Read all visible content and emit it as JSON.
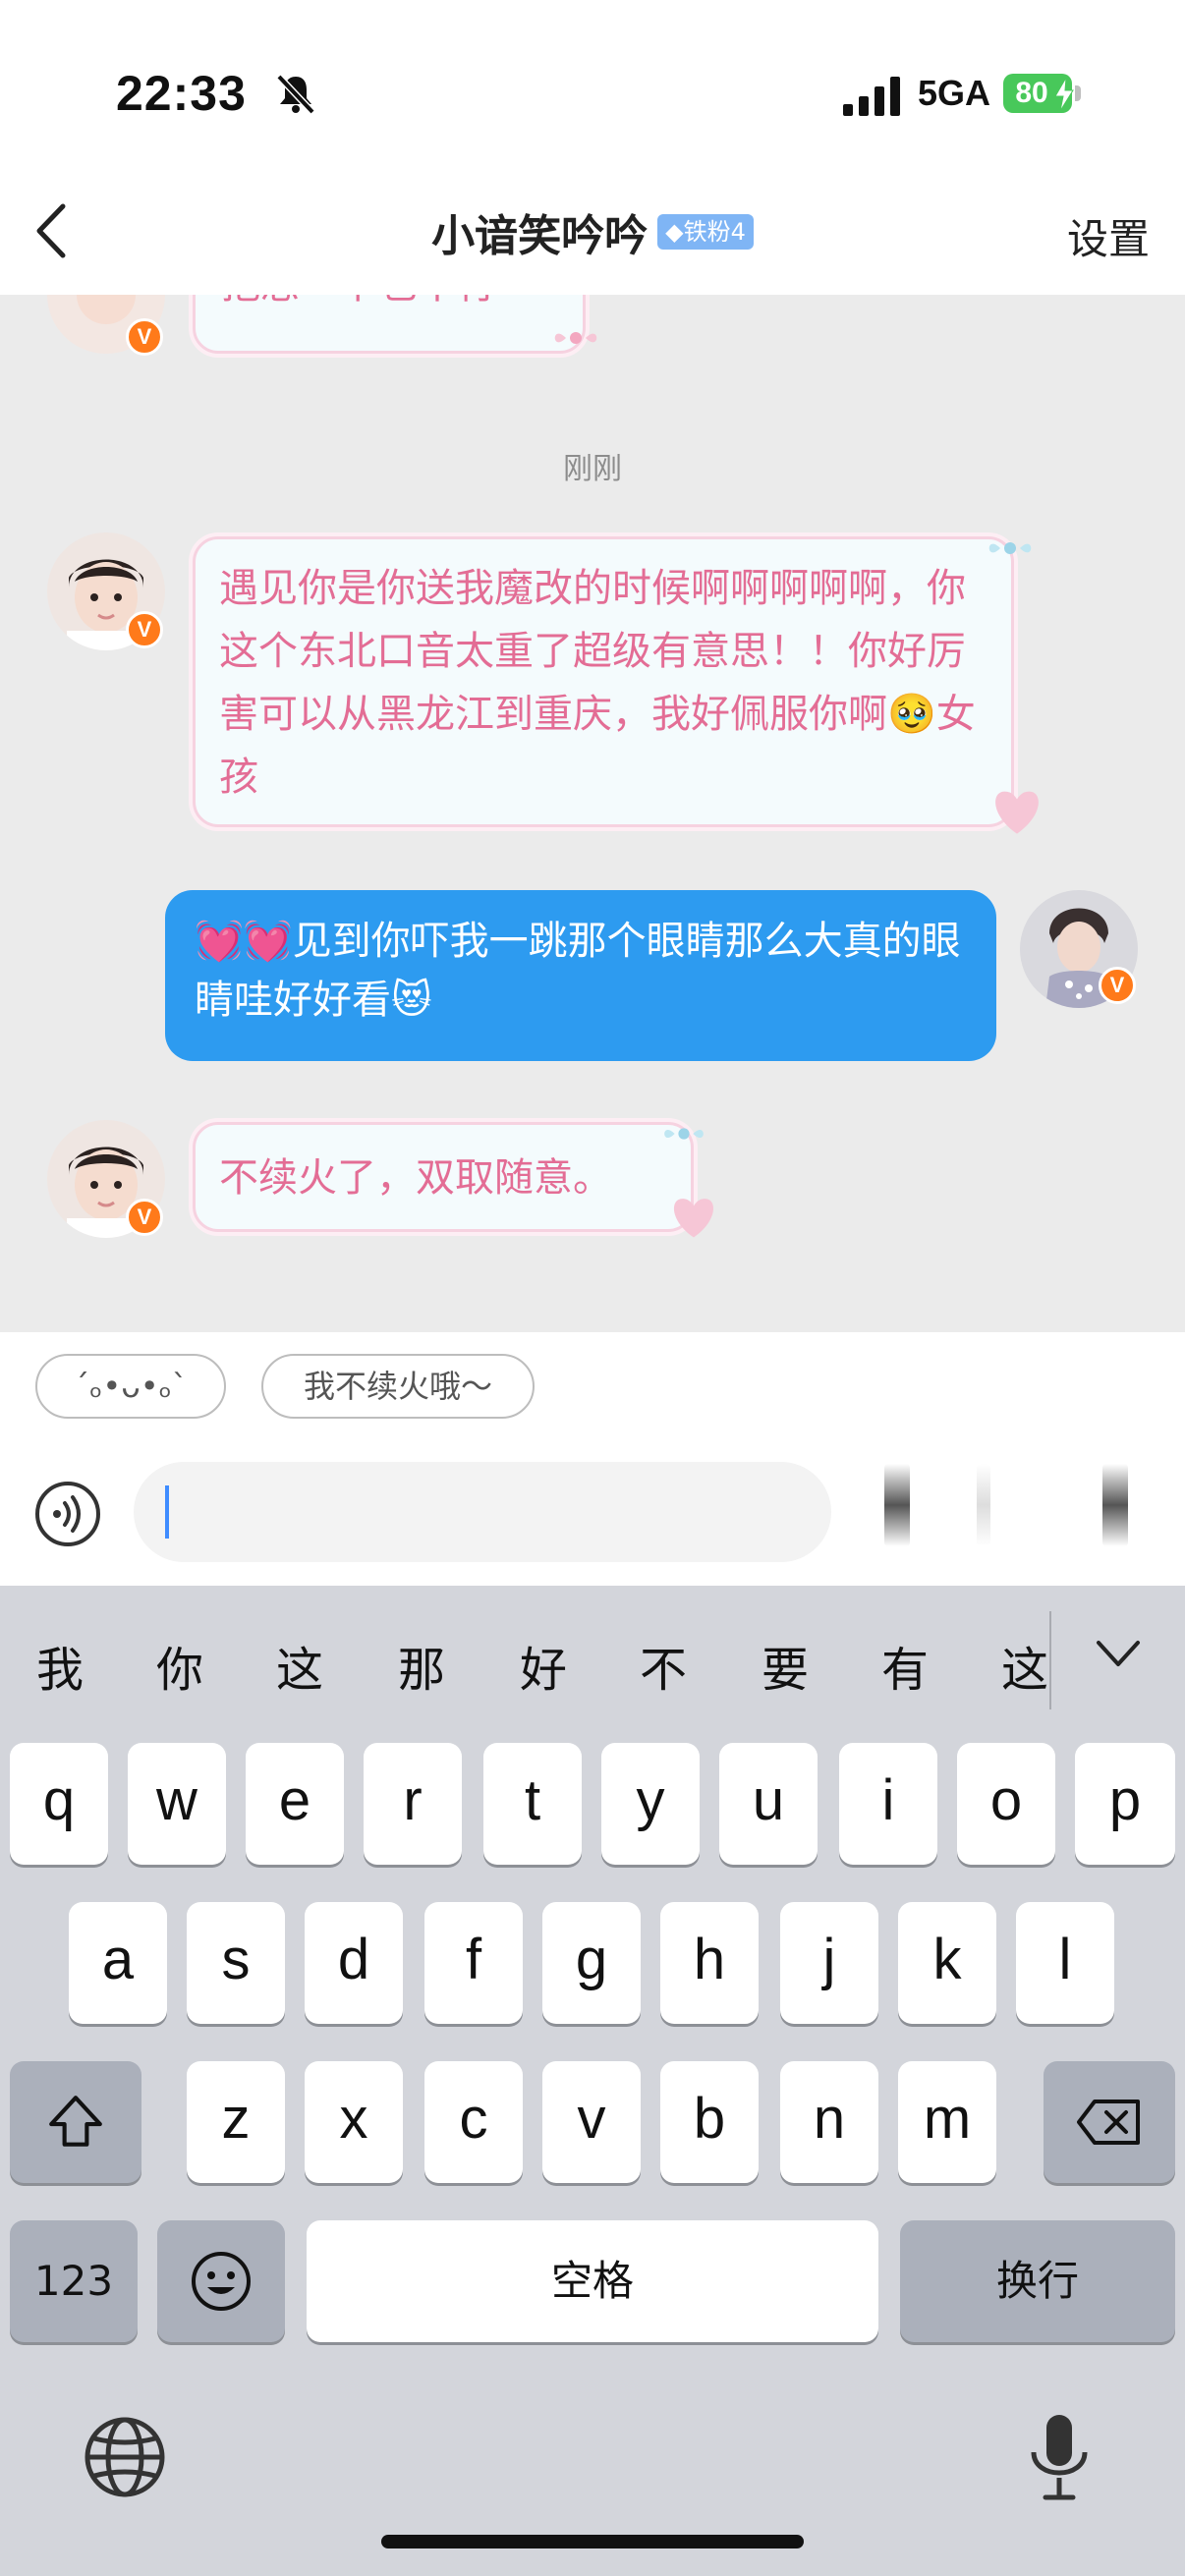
{
  "status_bar": {
    "time": "22:33",
    "network": "5GA",
    "battery": "80",
    "icons": [
      "bell-slash-icon",
      "signal-bars-icon",
      "battery-icon",
      "charging-bolt-icon"
    ]
  },
  "nav": {
    "back_icon": "chevron-left-icon",
    "title": "小谙笑吟吟",
    "fan_badge": "◆铁粉4",
    "settings": "设置"
  },
  "chat": {
    "partial_message": "抱怨一下也不行",
    "timestamp": "刚刚",
    "messages": [
      {
        "side": "incoming",
        "text": "遇见你是你送我魔改的时候啊啊啊啊啊，你这个东北口音太重了超级有意思！！你好厉害可以从黑龙江到重庆，我好佩服你啊🥹女孩"
      },
      {
        "side": "outgoing",
        "text": "💓💓见到你吓我一跳那个眼睛那么大真的眼睛哇好好看😻"
      },
      {
        "side": "incoming",
        "text": "不续火了，双取随意。"
      }
    ],
    "verified_badge": "V",
    "colors": {
      "incoming_text": "#e36d95",
      "incoming_bg": "#f4fbfd",
      "outgoing_bg": "#2d9bf0",
      "verified_badge": "#ff7a1a"
    }
  },
  "quick_replies": [
    "ˊₒ•ᴗ•ₒˋ",
    "我不续火哦～"
  ],
  "input": {
    "placeholder": "",
    "voice_icon": "voice-wave-icon"
  },
  "keyboard": {
    "candidates": [
      "我",
      "你",
      "这",
      "那",
      "好",
      "不",
      "要",
      "有",
      "这"
    ],
    "expand_icon": "chevron-down-icon",
    "row1": [
      "q",
      "w",
      "e",
      "r",
      "t",
      "y",
      "u",
      "i",
      "o",
      "p"
    ],
    "row2": [
      "a",
      "s",
      "d",
      "f",
      "g",
      "h",
      "j",
      "k",
      "l"
    ],
    "row3": [
      "z",
      "x",
      "c",
      "v",
      "b",
      "n",
      "m"
    ],
    "shift_icon": "shift-arrow-icon",
    "delete_icon": "backspace-icon",
    "numbers_label": "123",
    "emoji_icon": "smiley-icon",
    "space_label": "空格",
    "return_label": "换行",
    "globe_icon": "globe-icon",
    "mic_icon": "microphone-icon"
  }
}
